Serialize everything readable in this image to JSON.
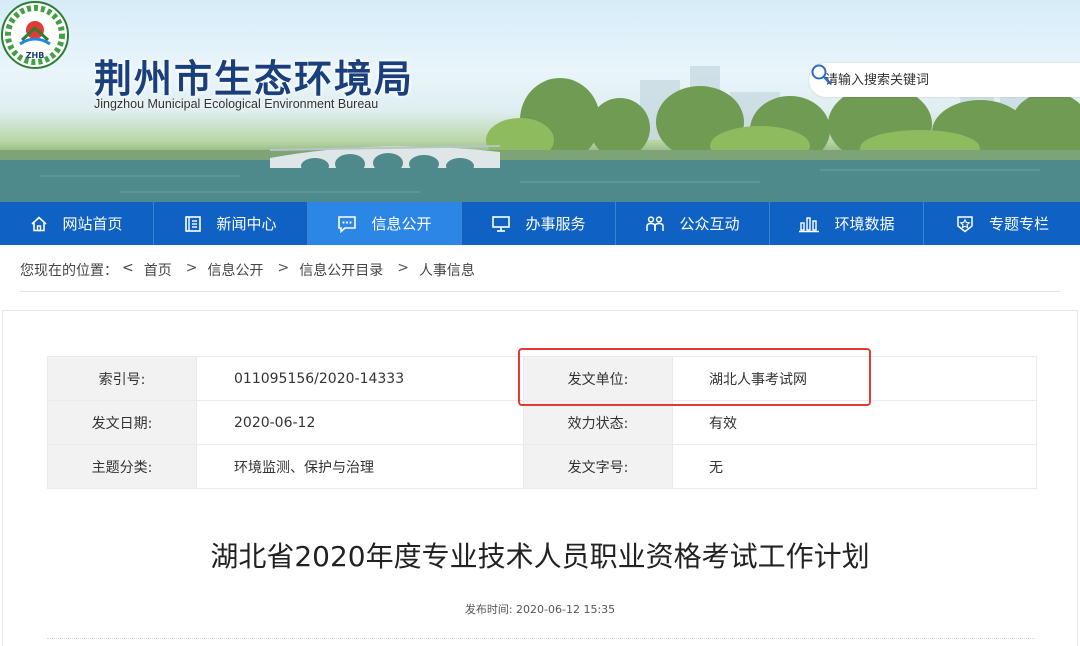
{
  "site": {
    "title": "荆州市生态环境局",
    "subtitle": "Jingzhou Municipal Ecological Environment Bureau",
    "logo_text": "ZHB"
  },
  "search": {
    "placeholder": "请输入搜索关键词"
  },
  "nav": {
    "items": [
      {
        "label": "网站首页",
        "icon": "home-icon"
      },
      {
        "label": "新闻中心",
        "icon": "news-icon"
      },
      {
        "label": "信息公开",
        "icon": "message-icon",
        "active": true
      },
      {
        "label": "办事服务",
        "icon": "monitor-icon"
      },
      {
        "label": "公众互动",
        "icon": "people-icon"
      },
      {
        "label": "环境数据",
        "icon": "chart-icon"
      },
      {
        "label": "专题专栏",
        "icon": "badge-icon"
      }
    ]
  },
  "breadcrumb": {
    "prefix": "您现在的位置：",
    "back": "<",
    "items": [
      "首页",
      "信息公开",
      "信息公开目录",
      "人事信息"
    ],
    "sep": ">"
  },
  "info": {
    "rows": [
      [
        {
          "label": "索引号:",
          "value": "011095156/2020-14333"
        },
        {
          "label": "发文单位:",
          "value": "湖北人事考试网"
        }
      ],
      [
        {
          "label": "发文日期:",
          "value": "2020-06-12"
        },
        {
          "label": "效力状态:",
          "value": "有效"
        }
      ],
      [
        {
          "label": "主题分类:",
          "value": "环境监测、保护与治理"
        },
        {
          "label": "发文字号:",
          "value": "无"
        }
      ]
    ]
  },
  "article": {
    "title": "湖北省2020年度专业技术人员职业资格考试工作计划",
    "publish_label": "发布时间:",
    "publish_time": "2020-06-12 15:35"
  },
  "colors": {
    "nav_bg": "#0f62c3",
    "nav_active": "#2c86e6",
    "title_blue": "#1a3f7d",
    "highlight": "#e53935"
  }
}
